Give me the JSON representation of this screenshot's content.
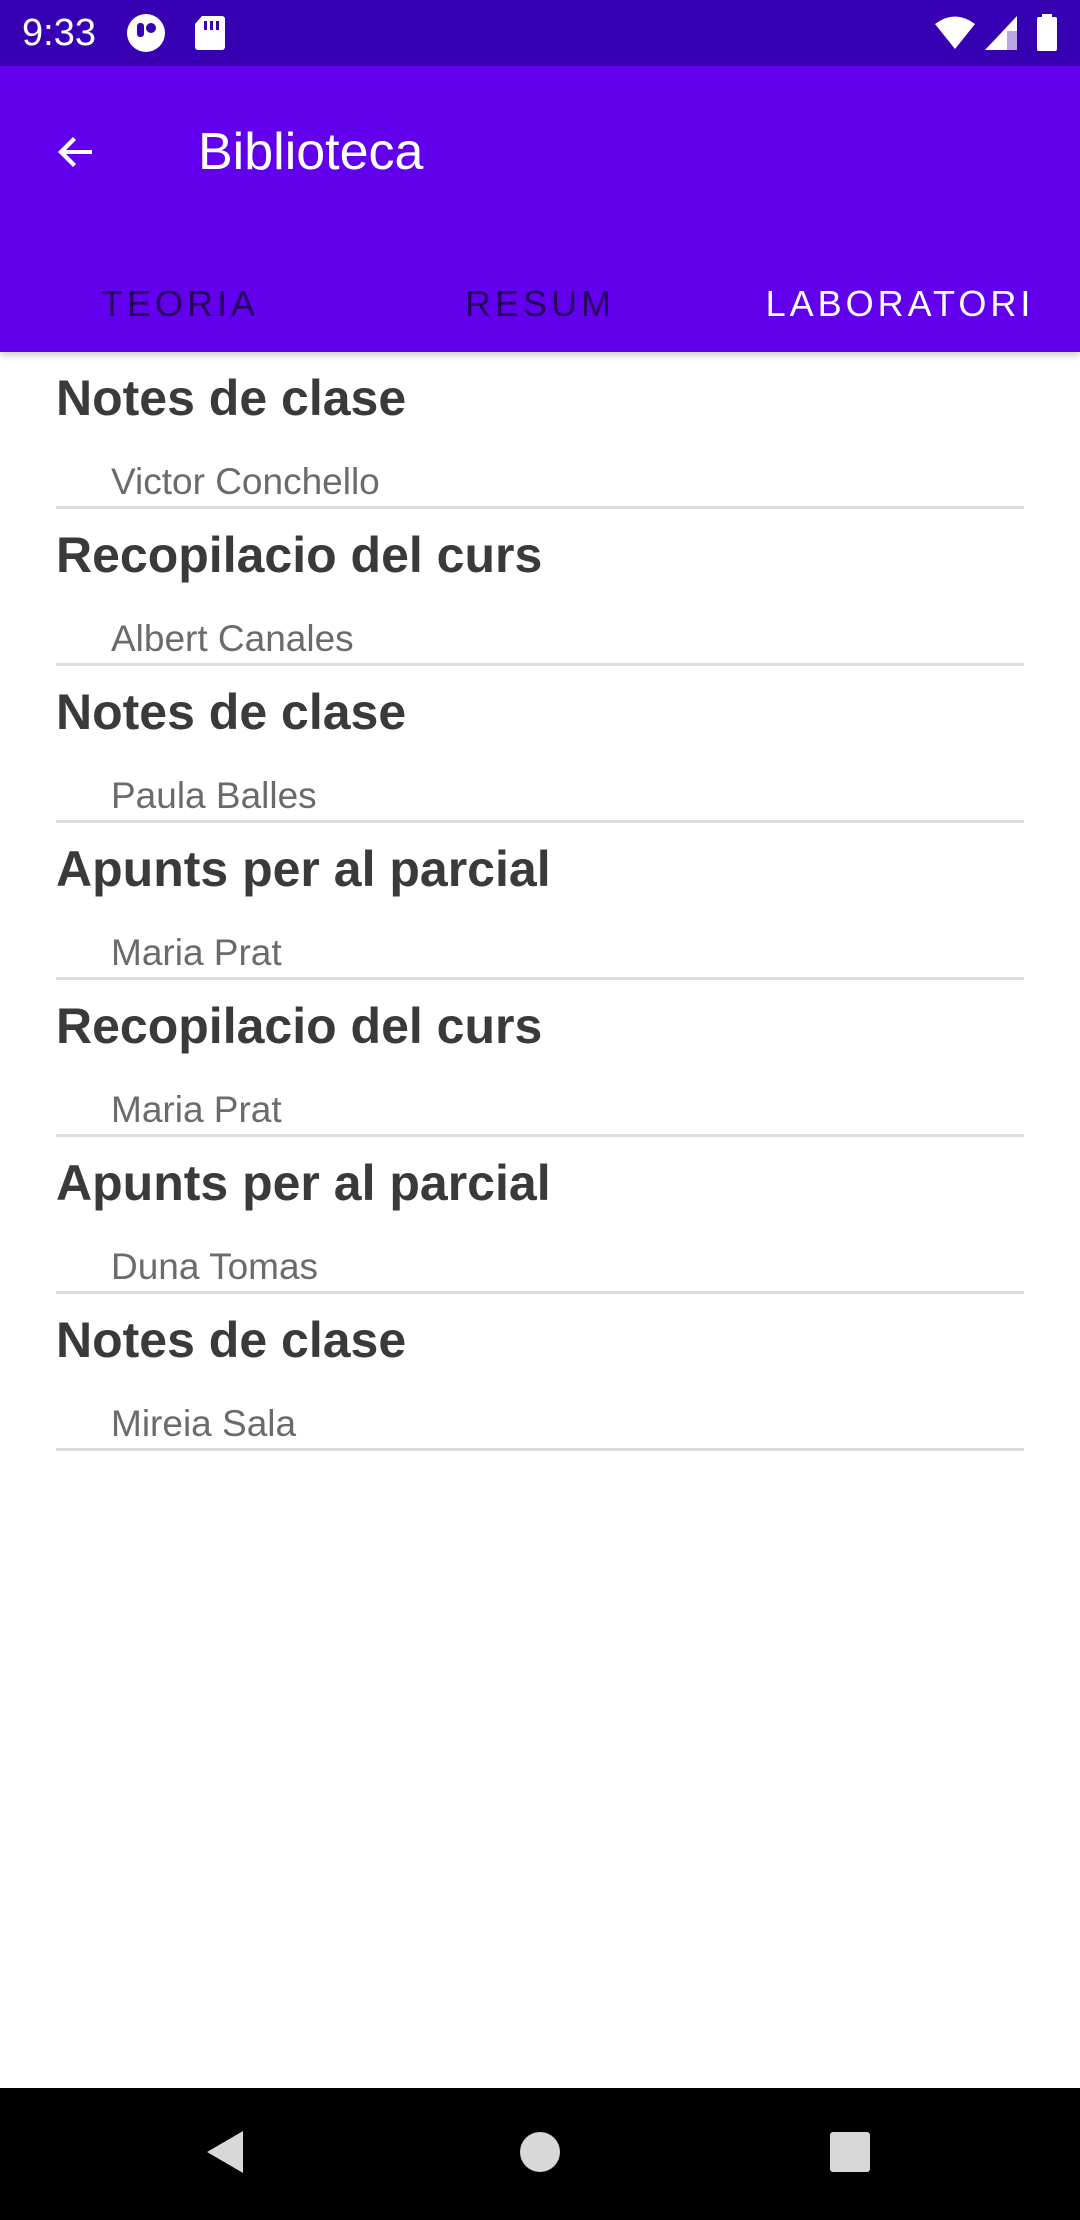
{
  "status_bar": {
    "time": "9:33",
    "left_icons": [
      "app-notification-icon",
      "sd-card-icon"
    ],
    "right_icons": [
      "wifi-icon",
      "cell-signal-icon",
      "battery-icon"
    ]
  },
  "app_bar": {
    "back_icon": "arrow-back-icon",
    "title": "Biblioteca",
    "background_color": "#6200ee"
  },
  "tabs": [
    {
      "label": "TEORIA",
      "active": false
    },
    {
      "label": "RESUM",
      "active": false
    },
    {
      "label": "LABORATORI",
      "active": true
    }
  ],
  "list": {
    "items": [
      {
        "title": "Notes de clase",
        "author": "Victor Conchello"
      },
      {
        "title": "Recopilacio del curs",
        "author": "Albert Canales"
      },
      {
        "title": "Notes de clase",
        "author": "Paula Balles"
      },
      {
        "title": "Apunts per al parcial",
        "author": "Maria Prat"
      },
      {
        "title": "Recopilacio del curs",
        "author": "Maria Prat"
      },
      {
        "title": "Apunts per al parcial",
        "author": "Duna Tomas"
      },
      {
        "title": "Notes de clase",
        "author": "Mireia Sala"
      }
    ]
  },
  "nav_bar": {
    "buttons": [
      "back-triangle-icon",
      "home-circle-icon",
      "recents-square-icon"
    ]
  }
}
